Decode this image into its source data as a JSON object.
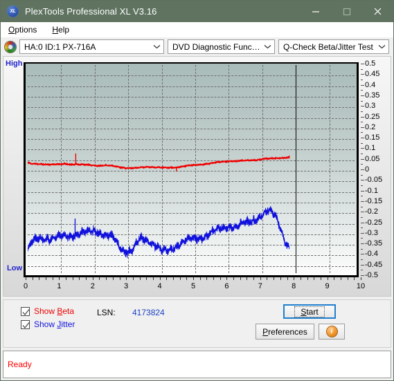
{
  "window": {
    "title": "PlexTools Professional XL V3.16",
    "logo_text": "XL",
    "minimize_label": "Minimize",
    "maximize_label": "Maximize",
    "close_label": "Close"
  },
  "menubar": {
    "items": [
      {
        "label": "Options",
        "accel": "O"
      },
      {
        "label": "Help",
        "accel": "H"
      }
    ]
  },
  "toolbar": {
    "drive_combo": "HA:0 ID:1  PX-716A",
    "function_combo": "DVD Diagnostic Functions",
    "test_combo": "Q-Check Beta/Jitter Test"
  },
  "controls": {
    "show_beta_label": "Show Beta",
    "show_beta_accel": "B",
    "show_beta_checked": true,
    "show_jitter_label": "Show Jitter",
    "show_jitter_accel": "J",
    "show_jitter_checked": true,
    "lsn_label": "LSN:",
    "lsn_value": "4173824",
    "start_label": "Start",
    "start_accel": "S",
    "preferences_label": "Preferences",
    "preferences_accel": "P",
    "info_label": "i"
  },
  "statusbar": {
    "text": "Ready"
  },
  "chart_data": {
    "type": "line",
    "title": "Q-Check Beta/Jitter Test",
    "xlabel": "",
    "ylabel": "",
    "xlim": [
      0,
      10
    ],
    "ylim": [
      -0.5,
      0.5
    ],
    "grid": true,
    "legend_position": "below-left",
    "left_axis_top_label": "High",
    "left_axis_bottom_label": "Low",
    "x_ticks": [
      0,
      1,
      2,
      3,
      4,
      5,
      6,
      7,
      8,
      9,
      10
    ],
    "y_ticks": [
      0.5,
      0.45,
      0.4,
      0.35,
      0.3,
      0.25,
      0.2,
      0.15,
      0.1,
      0.05,
      0,
      -0.05,
      -0.1,
      -0.15,
      -0.2,
      -0.25,
      -0.3,
      -0.35,
      -0.4,
      -0.45,
      -0.5
    ],
    "data_end_x": 8,
    "end_marker_x": 8,
    "series": [
      {
        "name": "Beta",
        "color": "#ee0000",
        "x": [
          0.0,
          0.1,
          0.2,
          0.3,
          0.4,
          0.5,
          0.6,
          0.7,
          0.8,
          0.9,
          1.0,
          1.1,
          1.2,
          1.3,
          1.4,
          1.5,
          1.6,
          1.7,
          1.8,
          1.9,
          2.0,
          2.1,
          2.2,
          2.3,
          2.4,
          2.5,
          2.6,
          2.7,
          2.8,
          2.9,
          3.0,
          3.1,
          3.2,
          3.3,
          3.4,
          3.5,
          3.6,
          3.7,
          3.8,
          3.9,
          4.0,
          4.1,
          4.2,
          4.3,
          4.4,
          4.5,
          4.6,
          4.7,
          4.8,
          4.9,
          5.0,
          5.1,
          5.2,
          5.3,
          5.4,
          5.5,
          5.6,
          5.7,
          5.8,
          5.9,
          6.0,
          6.1,
          6.2,
          6.3,
          6.4,
          6.5,
          6.6,
          6.7,
          6.8,
          6.9,
          7.0,
          7.1,
          7.2,
          7.3,
          7.4,
          7.5,
          7.6,
          7.7,
          7.8,
          7.9,
          8.0
        ],
        "y": [
          0.03,
          0.026,
          0.024,
          0.023,
          0.024,
          0.023,
          0.022,
          0.023,
          0.022,
          0.023,
          0.022,
          0.023,
          0.024,
          0.022,
          0.023,
          0.024,
          0.022,
          0.021,
          0.02,
          0.019,
          0.018,
          0.017,
          0.016,
          0.018,
          0.017,
          0.016,
          0.014,
          0.012,
          0.01,
          0.008,
          0.006,
          0.005,
          0.004,
          0.005,
          0.006,
          0.008,
          0.01,
          0.011,
          0.01,
          0.009,
          0.008,
          0.007,
          0.006,
          0.006,
          0.007,
          0.008,
          0.01,
          0.012,
          0.014,
          0.016,
          0.017,
          0.018,
          0.02,
          0.022,
          0.024,
          0.026,
          0.028,
          0.03,
          0.032,
          0.034,
          0.036,
          0.038,
          0.039,
          0.039,
          0.038,
          0.039,
          0.04,
          0.041,
          0.042,
          0.043,
          0.044,
          0.046,
          0.048,
          0.05,
          0.049,
          0.051,
          0.052,
          0.053,
          0.054,
          0.055,
          0.056
        ],
        "noise": 0.004,
        "spikes": [
          {
            "x": 1.47,
            "y": 0.075
          },
          {
            "x": 4.55,
            "y": -0.012
          }
        ]
      },
      {
        "name": "Jitter",
        "color": "#1111dd",
        "x": [
          0.0,
          0.1,
          0.2,
          0.3,
          0.4,
          0.5,
          0.6,
          0.7,
          0.8,
          0.9,
          1.0,
          1.1,
          1.2,
          1.3,
          1.4,
          1.5,
          1.6,
          1.7,
          1.8,
          1.9,
          2.0,
          2.1,
          2.2,
          2.3,
          2.4,
          2.5,
          2.6,
          2.7,
          2.8,
          2.9,
          3.0,
          3.1,
          3.2,
          3.3,
          3.4,
          3.5,
          3.6,
          3.7,
          3.8,
          3.9,
          4.0,
          4.1,
          4.2,
          4.3,
          4.4,
          4.5,
          4.6,
          4.7,
          4.8,
          4.9,
          5.0,
          5.1,
          5.2,
          5.3,
          5.4,
          5.5,
          5.6,
          5.7,
          5.8,
          5.9,
          6.0,
          6.1,
          6.2,
          6.3,
          6.4,
          6.5,
          6.6,
          6.7,
          6.8,
          6.9,
          7.0,
          7.1,
          7.2,
          7.3,
          7.4,
          7.5,
          7.6,
          7.7,
          7.8,
          7.9,
          8.0
        ],
        "y": [
          -0.39,
          -0.36,
          -0.345,
          -0.34,
          -0.335,
          -0.332,
          -0.33,
          -0.335,
          -0.332,
          -0.33,
          -0.328,
          -0.325,
          -0.322,
          -0.318,
          -0.315,
          -0.312,
          -0.31,
          -0.308,
          -0.305,
          -0.3,
          -0.298,
          -0.295,
          -0.3,
          -0.31,
          -0.318,
          -0.322,
          -0.33,
          -0.348,
          -0.372,
          -0.385,
          -0.39,
          -0.392,
          -0.39,
          -0.37,
          -0.345,
          -0.338,
          -0.34,
          -0.345,
          -0.35,
          -0.36,
          -0.378,
          -0.392,
          -0.398,
          -0.395,
          -0.388,
          -0.375,
          -0.362,
          -0.352,
          -0.345,
          -0.34,
          -0.338,
          -0.335,
          -0.332,
          -0.328,
          -0.322,
          -0.315,
          -0.308,
          -0.3,
          -0.295,
          -0.288,
          -0.282,
          -0.275,
          -0.272,
          -0.275,
          -0.278,
          -0.272,
          -0.265,
          -0.258,
          -0.252,
          -0.245,
          -0.238,
          -0.228,
          -0.218,
          -0.208,
          -0.205,
          -0.212,
          -0.228,
          -0.262,
          -0.31,
          -0.355,
          -0.38
        ],
        "noise": 0.028,
        "spikes": [
          {
            "x": 1.45,
            "y": -0.238
          }
        ]
      }
    ]
  }
}
